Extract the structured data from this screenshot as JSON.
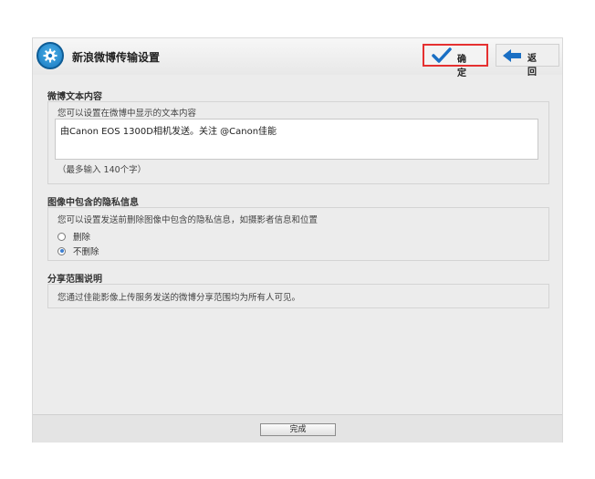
{
  "header": {
    "title": "新浪微博传输设置",
    "confirm_label": "确定",
    "back_label": "返回"
  },
  "icons": {
    "logo": "gear-icon",
    "confirm": "checkmark-icon",
    "back": "arrow-left-icon"
  },
  "colors": {
    "confirm_highlight": "#e53030",
    "check_blue": "#1a6fc4",
    "radio_selected": "#3d7fd1"
  },
  "section_text": {
    "title": "微博文本内容",
    "hint": "您可以设置在微博中显示的文本内容",
    "value": "由Canon EOS 1300D相机发送。关注 @Canon佳能",
    "limit_note": "（最多输入 140个字）"
  },
  "section_privacy": {
    "title": "图像中包含的隐私信息",
    "hint": "您可以设置发送前删除图像中包含的隐私信息，如摄影者信息和位置",
    "options": [
      {
        "label": "删除",
        "selected": false
      },
      {
        "label": "不删除",
        "selected": true
      }
    ]
  },
  "section_share": {
    "title": "分享范围说明",
    "hint": "您通过佳能影像上传服务发送的微博分享范围均为所有人可见。"
  },
  "footer": {
    "done_label": "完成"
  }
}
